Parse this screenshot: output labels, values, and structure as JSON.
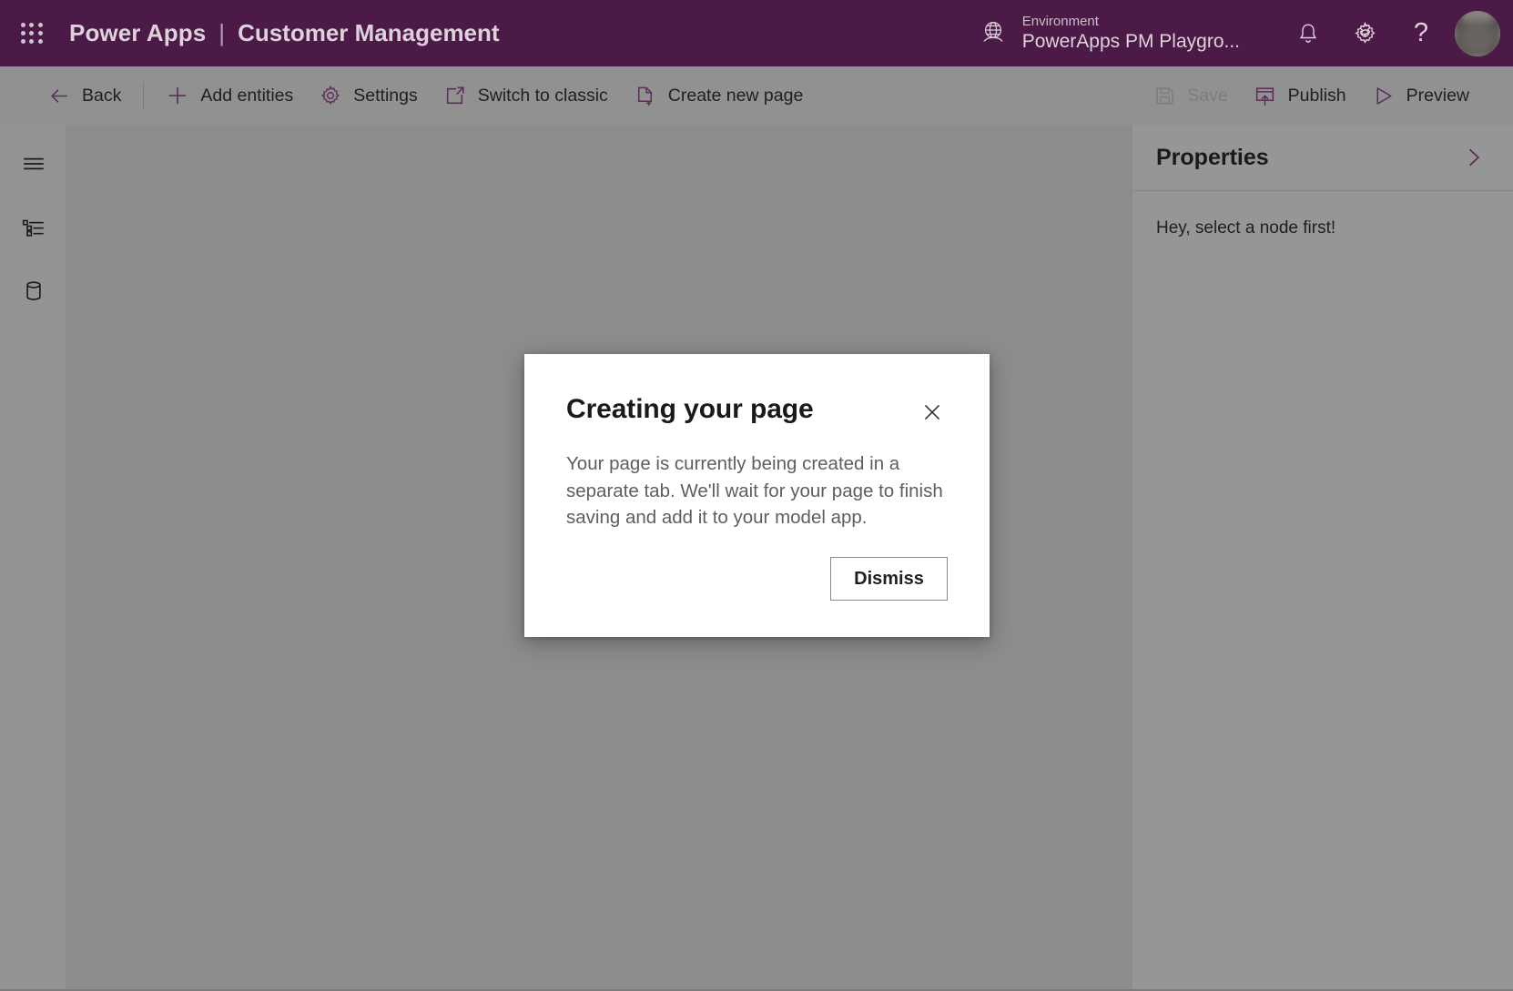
{
  "header": {
    "waffle_icon": "app-launcher-waffle-icon",
    "product": "Power Apps",
    "separator": "|",
    "app_name": "Customer Management",
    "environment": {
      "icon": "globe-icon",
      "label": "Environment",
      "value": "PowerApps PM Playgro..."
    },
    "notifications_icon": "bell-icon",
    "settings_icon": "gear-icon",
    "help_icon": "question-mark-icon",
    "help_glyph": "?",
    "avatar": "user-avatar",
    "background_color": "#4c1a47",
    "text_color": "#ddd2db"
  },
  "command_bar": {
    "background_color": "#919191",
    "accent_color": "#5c2d5a",
    "left_items": [
      {
        "label": "Back",
        "icon": "arrow-left-icon",
        "disabled": false
      },
      {
        "label": "Add entities",
        "icon": "plus-icon",
        "disabled": false
      },
      {
        "label": "Settings",
        "icon": "gear-icon",
        "disabled": false
      },
      {
        "label": "Switch to classic",
        "icon": "open-in-new-window-icon",
        "disabled": false
      },
      {
        "label": "Create new page",
        "icon": "new-page-icon",
        "disabled": false
      }
    ],
    "right_items": [
      {
        "label": "Save",
        "icon": "floppy-disk-icon",
        "disabled": true
      },
      {
        "label": "Publish",
        "icon": "publish-upload-icon",
        "disabled": false
      },
      {
        "label": "Preview",
        "icon": "play-triangle-icon",
        "disabled": false
      }
    ]
  },
  "left_rail": {
    "items": [
      {
        "name": "hamburger-menu-icon",
        "label": "Menu"
      },
      {
        "name": "tree-view-icon",
        "label": "Tree view"
      },
      {
        "name": "database-icon",
        "label": "Data"
      }
    ]
  },
  "canvas": {
    "background_color": "#8d8b8b"
  },
  "properties_panel": {
    "title": "Properties",
    "collapse_icon": "chevron-right-icon",
    "empty_message": "Hey, select a node first!",
    "background_color": "#969696"
  },
  "dialog": {
    "title": "Creating your page",
    "close_icon": "close-x-icon",
    "body": "Your page is currently being created in a separate tab. We'll wait for your page to finish saving and add it to your model app.",
    "primary_button": "Dismiss"
  }
}
